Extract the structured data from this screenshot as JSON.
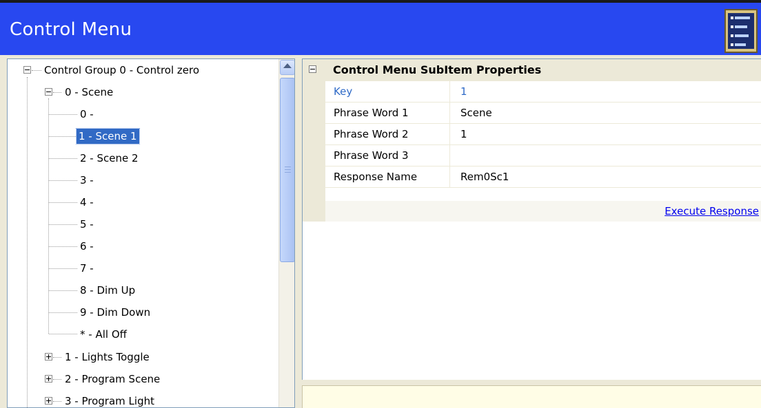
{
  "window": {
    "title": "Control Menu"
  },
  "header": {
    "icon": "control-panel-icon"
  },
  "tree": {
    "root": {
      "label": "Control Group 0 - Control zero",
      "expanded": true
    },
    "groups": [
      {
        "label": "0 - Scene",
        "expanded": true
      },
      {
        "label": "1 - Lights Toggle",
        "expanded": false
      },
      {
        "label": "2 - Program Scene",
        "expanded": false
      },
      {
        "label": "3 - Program Light",
        "expanded": false
      }
    ],
    "scene_items": [
      "0 -",
      "1 - Scene 1",
      "2 - Scene 2",
      "3 -",
      "4 -",
      "5 -",
      "6 -",
      "7 -",
      "8 - Dim Up",
      "9 - Dim Down",
      "* - All Off"
    ],
    "selected_item": "1 - Scene 1"
  },
  "properties": {
    "title": "Control Menu SubItem Properties",
    "rows": [
      {
        "key": "Key",
        "value": "1"
      },
      {
        "key": "Phrase Word 1",
        "value": "Scene"
      },
      {
        "key": "Phrase Word 2",
        "value": "1"
      },
      {
        "key": "Phrase Word 3",
        "value": ""
      },
      {
        "key": "Response Name",
        "value": "Rem0Sc1"
      }
    ],
    "execute_link": "Execute Response"
  },
  "colors": {
    "header_bg": "#2848f0",
    "selection": "#316ac5",
    "key_text": "#2f6ac7",
    "link": "#0000ee"
  }
}
